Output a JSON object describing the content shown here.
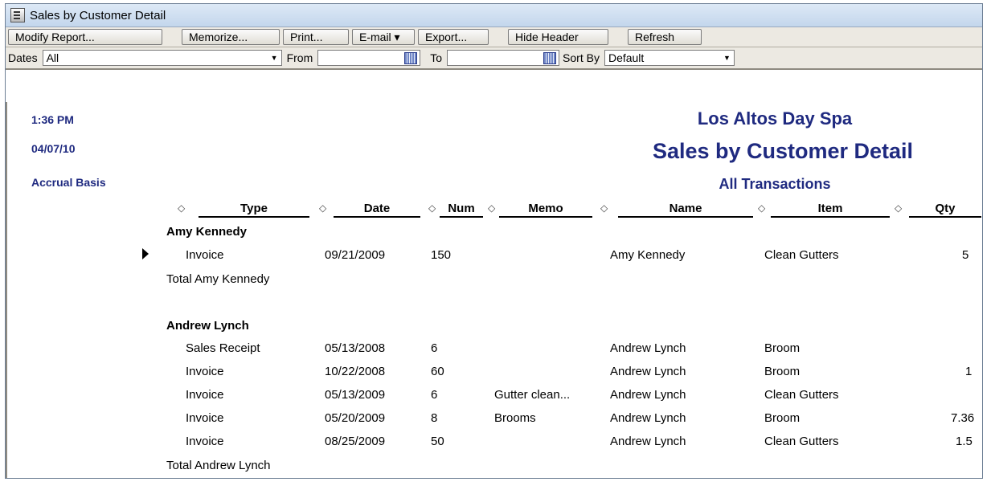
{
  "window": {
    "title": "Sales by Customer Detail"
  },
  "toolbar": {
    "modify": "Modify Report...",
    "memorize": "Memorize...",
    "print": "Print...",
    "email": "E-mail ▾",
    "export": "Export...",
    "hide_header": "Hide Header",
    "refresh": "Refresh"
  },
  "filters": {
    "dates_label": "Dates",
    "dates_value": "All",
    "from_label": "From",
    "to_label": "To",
    "sort_label": "Sort By",
    "sort_value": "Default"
  },
  "report": {
    "time": "1:36 PM",
    "date": "04/07/10",
    "basis": "Accrual Basis",
    "company": "Los Altos Day Spa",
    "title": "Sales by Customer Detail",
    "subtitle": "All Transactions",
    "columns": [
      "Type",
      "Date",
      "Num",
      "Memo",
      "Name",
      "Item",
      "Qty"
    ],
    "groups": [
      {
        "name": "Amy Kennedy",
        "rows": [
          {
            "type": "Invoice",
            "date": "09/21/2009",
            "num": "150",
            "memo": "",
            "name": "Amy Kennedy",
            "item": "Clean Gutters",
            "qty": "5"
          }
        ],
        "total": "Total Amy Kennedy"
      },
      {
        "name": "Andrew Lynch",
        "rows": [
          {
            "type": "Sales Receipt",
            "date": "05/13/2008",
            "num": "6",
            "memo": "",
            "name": "Andrew Lynch",
            "item": "Broom",
            "qty": ""
          },
          {
            "type": "Invoice",
            "date": "10/22/2008",
            "num": "60",
            "memo": "",
            "name": "Andrew Lynch",
            "item": "Broom",
            "qty": "1"
          },
          {
            "type": "Invoice",
            "date": "05/13/2009",
            "num": "6",
            "memo": "Gutter clean...",
            "name": "Andrew Lynch",
            "item": "Clean Gutters",
            "qty": ""
          },
          {
            "type": "Invoice",
            "date": "05/20/2009",
            "num": "8",
            "memo": "Brooms",
            "name": "Andrew Lynch",
            "item": "Broom",
            "qty": "7.36"
          },
          {
            "type": "Invoice",
            "date": "08/25/2009",
            "num": "50",
            "memo": "",
            "name": "Andrew Lynch",
            "item": "Clean Gutters",
            "qty": "1.5"
          }
        ],
        "total": "Total Andrew Lynch"
      }
    ]
  },
  "colors": {
    "header_text": "#1f2a80",
    "toolbar_bg": "#ece9e2"
  }
}
